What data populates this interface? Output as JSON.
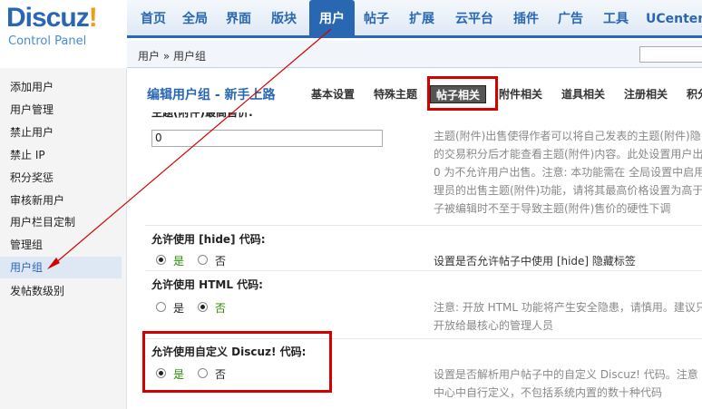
{
  "logo": {
    "brand": "Discuz",
    "bang": "!",
    "subtitle": "Control Panel"
  },
  "topnav": {
    "tabs": [
      "首页",
      "全局",
      "界面",
      "版块",
      "用户",
      "帖子",
      "扩展",
      "云平台",
      "插件",
      "广告",
      "工具",
      "UCenter"
    ],
    "active": "用户"
  },
  "breadcrumb": "用户 » 用户组",
  "sidebar": {
    "items": [
      "添加用户",
      "用户管理",
      "禁止用户",
      "禁止 IP",
      "积分奖惩",
      "审核新用户",
      "用户栏目定制",
      "管理组",
      "用户组",
      "发帖数级别"
    ],
    "active": "用户组"
  },
  "main": {
    "title": "编辑用户组 - 新手上路",
    "subtabs": [
      "基本设置",
      "特殊主题",
      "帖子相关",
      "附件相关",
      "道具相关",
      "注册相关",
      "积分"
    ],
    "active_subtab": "帖子相关",
    "cut_title": "主题(附件)最高售价:",
    "max_price_value": "0",
    "max_price_desc": [
      "主题(附件)出售使得作者可以将自己发表的主题(附件)隐",
      "的交易积分后才能查看主题(附件)内容。此处设置用户出",
      "0 为不允许用户出售。注意: 本功能需在 全局设置中启用",
      "理员的出售主题(附件)功能，请将其最高价格设置为高于",
      "子被编辑时不至于导致主题(附件)售价的硬性下调"
    ],
    "hide": {
      "title": "允许使用 [hide] 代码:",
      "yes": "是",
      "no": "否",
      "value": "yes",
      "desc": "设置是否允许帖子中使用 [hide] 隐藏标签"
    },
    "html": {
      "title": "允许使用 HTML 代码:",
      "yes": "是",
      "no": "否",
      "value": "no",
      "desc": [
        "注意: 开放 HTML 功能将产生安全隐患，请慎用。建议只",
        "开放给最核心的管理人员"
      ]
    },
    "custom": {
      "title": "允许使用自定义 Discuz! 代码:",
      "yes": "是",
      "no": "否",
      "value": "yes",
      "desc": [
        "设置是否解析用户帖子中的自定义 Discuz! 代码。注意",
        "中心中自行定义，不包括系统内置的数十种代码"
      ]
    }
  },
  "colors": {
    "accent": "#2a67b3",
    "highlight": "#d40000",
    "active_bg": "#dde8f4"
  }
}
